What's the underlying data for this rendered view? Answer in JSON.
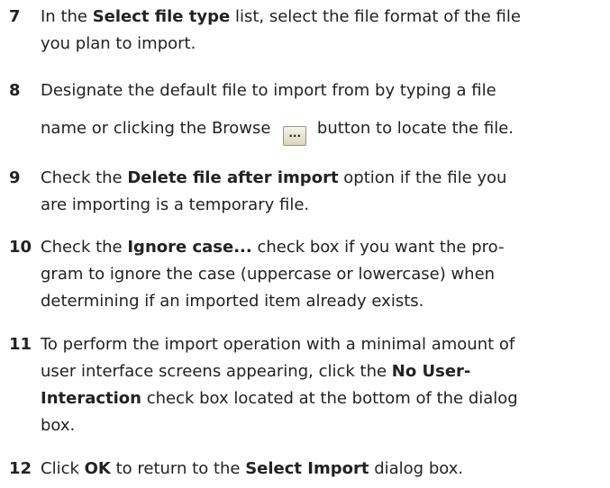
{
  "steps": [
    {
      "number": "7",
      "lines": [
        [
          "In the ",
          {
            "b": "Select file type"
          },
          " list, select the file format of the file"
        ],
        [
          "you plan to import."
        ]
      ]
    },
    {
      "number": "8",
      "lines": [
        [
          "Designate the default file to import from by typing a file"
        ],
        [
          "name or clicking the Browse ",
          {
            "btn": "..."
          },
          " button to locate the file."
        ]
      ]
    },
    {
      "number": "9",
      "lines": [
        [
          "Check the ",
          {
            "b": "Delete file after import"
          },
          " option if the file you"
        ],
        [
          "are importing is a temporary file."
        ]
      ]
    },
    {
      "number": "10",
      "lines": [
        [
          "Check the ",
          {
            "b": "Ignore case..."
          },
          " check box if you want the pro-"
        ],
        [
          "gram to ignore the case (uppercase or lowercase) when"
        ],
        [
          "determining if an imported item already exists."
        ]
      ]
    },
    {
      "number": "11",
      "lines": [
        [
          "To perform the import operation with a minimal amount of"
        ],
        [
          "user interface screens appearing, click the ",
          {
            "b": "No User-"
          }
        ],
        [
          {
            "b": "Interaction"
          },
          " check box located at the bottom of the dialog"
        ],
        [
          "box."
        ]
      ]
    },
    {
      "number": "12",
      "lines": [
        [
          "Click ",
          {
            "b": "OK"
          },
          " to return to the ",
          {
            "b": "Select Import"
          },
          " dialog box."
        ]
      ]
    }
  ]
}
